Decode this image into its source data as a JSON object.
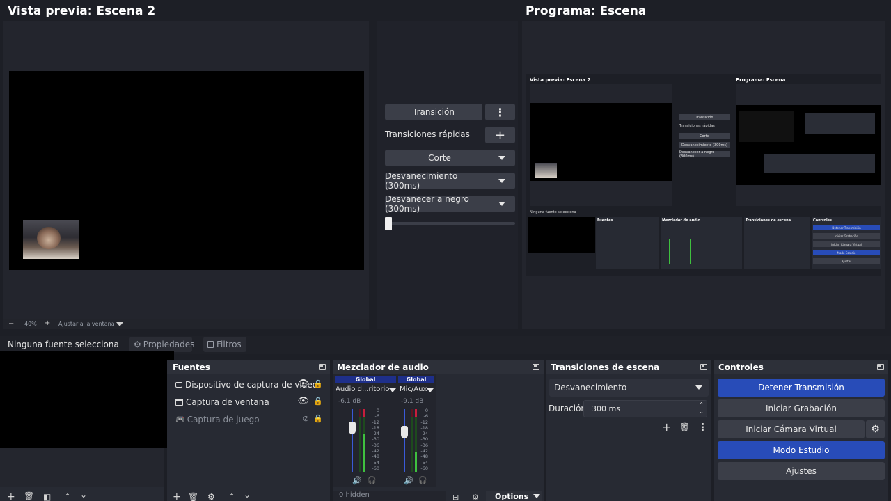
{
  "preview": {
    "title": "Vista previa: Escena 2"
  },
  "program": {
    "title": "Programa: Escena"
  },
  "preview_bar": {
    "zoom": "40%",
    "fit_label": "Ajustar a la ventana"
  },
  "transitions_panel": {
    "transition_button": "Transición",
    "quick_label": "Transiciones rápidas",
    "items": [
      "Corte",
      "Desvanecimiento (300ms)",
      "Desvanecer a negro (300ms)"
    ]
  },
  "source_bar": {
    "status": "Ninguna fuente selecciona",
    "properties": "Propiedades",
    "filters": "Filtros"
  },
  "sources": {
    "title": "Fuentes",
    "items": [
      "Dispositivo de captura de video",
      "Captura de ventana",
      "Captura de juego"
    ]
  },
  "mixer": {
    "title": "Mezclador de audio",
    "channels": [
      {
        "badge": "Global",
        "name": "Audio d...ritorio",
        "db": "-6.1 dB"
      },
      {
        "badge": "Global",
        "name": "Mic/Aux",
        "db": "-9.1 dB"
      }
    ],
    "scale": [
      "0",
      "-6",
      "-12",
      "-18",
      "-24",
      "-30",
      "-36",
      "-42",
      "-48",
      "-54",
      "-60"
    ],
    "hidden": "0 hidden",
    "options": "Options"
  },
  "scene_transitions": {
    "title": "Transiciones de escena",
    "selected": "Desvanecimiento",
    "duration_label": "Duración",
    "duration_value": "300 ms"
  },
  "controls": {
    "title": "Controles",
    "stop_stream": "Detener Transmisión",
    "start_record": "Iniciar Grabación",
    "virtual_cam": "Iniciar Cámara Virtual",
    "studio_mode": "Modo Estudio",
    "settings": "Ajustes"
  },
  "mini": {
    "preview_title": "Vista previa: Escena 2",
    "program_title": "Programa: Escena",
    "items": [
      "Transición",
      "Transiciones rápidas",
      "Corte",
      "Desvanecimiento (300ms)",
      "Desvanecer a negro (300ms)"
    ],
    "status": "Ninguna fuente selecciona",
    "docks": [
      "Fuentes",
      "Mezclador de audio",
      "Transiciones de escena",
      "Controles"
    ],
    "control_labels": [
      "Detener Transmisión",
      "Iniciar Grabación",
      "Iniciar Cámara Virtual",
      "Modo Estudio",
      "Ajustes"
    ]
  },
  "colors": {
    "accent": "#284cb8",
    "meter_green": "#3fc03f",
    "meter_red": "#c81e3c",
    "background": "#1d1f26"
  }
}
